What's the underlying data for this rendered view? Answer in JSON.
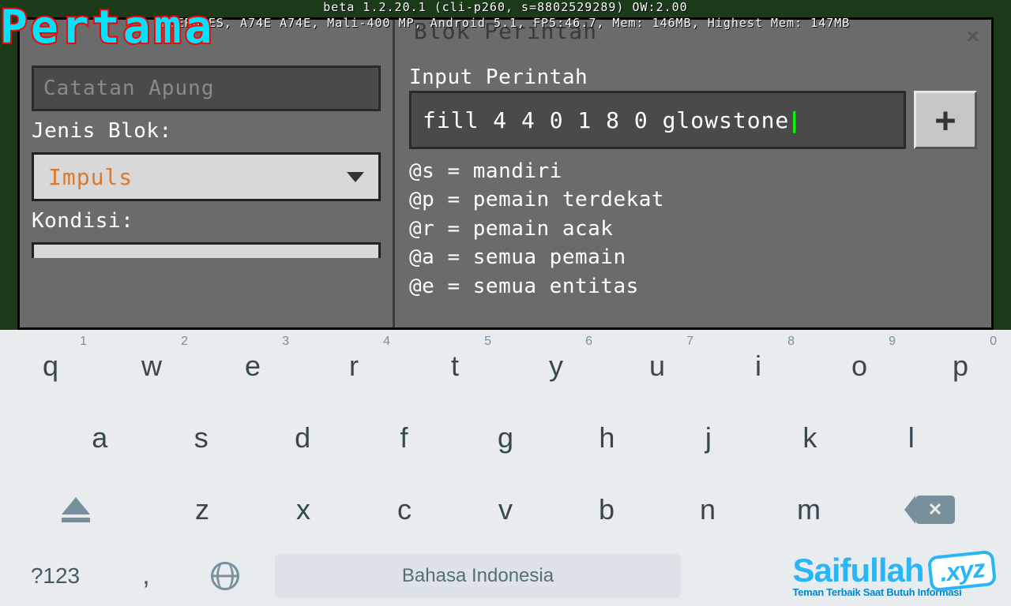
{
  "overlay": {
    "label": "Pertama"
  },
  "debug": {
    "line1": "beta 1.2.20.1 (cli-p260, s=8802529289) OW:2.00",
    "line2": "EVERGOES, A74E A74E, Mali-400 MP, Android 5.1, FP5:46.7, Mem: 146MB, Highest Mem: 147MB"
  },
  "panel": {
    "title": "Blok Perintah",
    "close": "×",
    "left": {
      "noteField": "Catatan Apung",
      "blockTypeLabel": "Jenis Blok:",
      "blockTypeValue": "Impuls",
      "conditionLabel": "Kondisi:"
    },
    "right": {
      "inputLabel": "Input Perintah",
      "command": "fill 4 4 0 1 8 0 glowstone",
      "plus": "+",
      "hints": {
        "s": "@s = mandiri",
        "p": "@p = pemain terdekat",
        "r": "@r = pemain acak",
        "a": "@a = semua pemain",
        "e": "@e = semua entitas"
      }
    }
  },
  "keyboard": {
    "row1": [
      {
        "k": "q",
        "n": "1"
      },
      {
        "k": "w",
        "n": "2"
      },
      {
        "k": "e",
        "n": "3"
      },
      {
        "k": "r",
        "n": "4"
      },
      {
        "k": "t",
        "n": "5"
      },
      {
        "k": "y",
        "n": "6"
      },
      {
        "k": "u",
        "n": "7"
      },
      {
        "k": "i",
        "n": "8"
      },
      {
        "k": "o",
        "n": "9"
      },
      {
        "k": "p",
        "n": "0"
      }
    ],
    "row2": [
      "a",
      "s",
      "d",
      "f",
      "g",
      "h",
      "j",
      "k",
      "l"
    ],
    "row3": [
      "z",
      "x",
      "c",
      "v",
      "b",
      "n",
      "m"
    ],
    "fn": "?123",
    "comma": ",",
    "spacebar": "Bahasa Indonesia"
  },
  "watermark": {
    "main": "Saifullah",
    "suffix": ".xyz",
    "sub": "Teman Terbaik Saat Butuh Informasi"
  }
}
